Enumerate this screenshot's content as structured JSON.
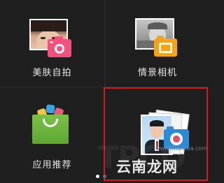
{
  "tiles": [
    {
      "label": "美肤自拍",
      "icon": "beauty-selfie-icon"
    },
    {
      "label": "情景相机",
      "icon": "scene-camera-icon"
    },
    {
      "label": "应用推荐",
      "icon": "app-recommend-bag-icon"
    },
    {
      "label": "",
      "icon": "id-photo-icon"
    }
  ],
  "watermark": {
    "text": "云南龙网",
    "site": "www.xiazaiba.com",
    "ghost": "TPCO"
  },
  "pagination": {
    "count": 2,
    "active_index": 1
  },
  "colors": {
    "background": "#1f1f1f",
    "highlight_border": "#d11c1c",
    "camera_pink": "#f2507d",
    "camera_orange": "#f2a51c",
    "bag_green": "#6cb33e",
    "camera_blue": "#2c8bd6"
  }
}
